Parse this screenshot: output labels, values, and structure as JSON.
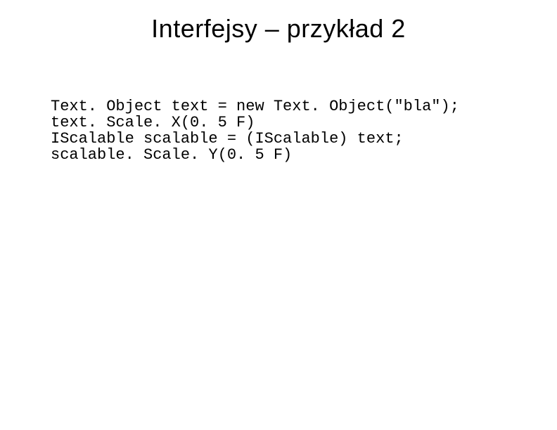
{
  "title": "Interfejsy – przykład 2",
  "code": {
    "line1": "Text. Object text = new Text. Object(\"bla\");",
    "line2": "text. Scale. X(0. 5 F)",
    "line3": "IScalable scalable = (IScalable) text;",
    "line4": "scalable. Scale. Y(0. 5 F)"
  }
}
